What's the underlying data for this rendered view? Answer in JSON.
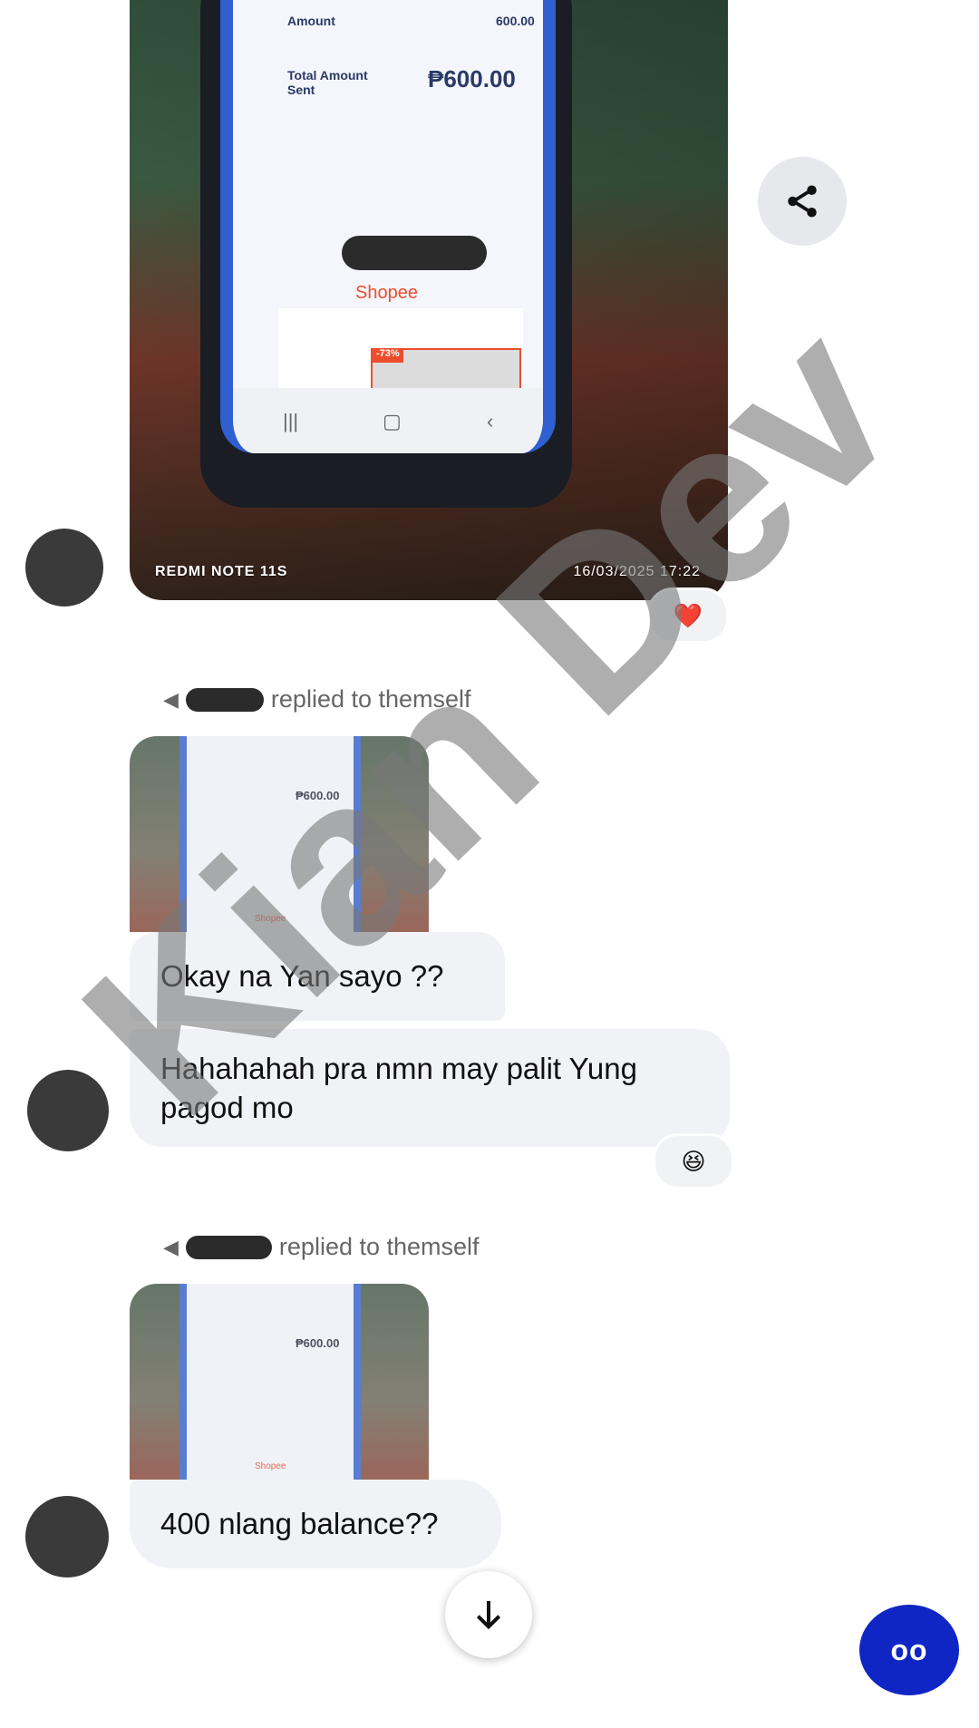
{
  "photo": {
    "screen_amount_label": "Amount",
    "screen_amount_value": "600.00",
    "screen_total_label": "Total Amount Sent",
    "screen_total_value": "₱600.00",
    "screen_shopee": "Shopee",
    "screen_promo": "-73%",
    "caption_device": "REDMI NOTE 11S",
    "caption_timestamp": "16/03/2025  17:22",
    "icon": "image"
  },
  "reactions": {
    "first": "❤️",
    "second": "😆"
  },
  "replies": [
    {
      "label": "replied to themself"
    },
    {
      "label": "replied to themself"
    }
  ],
  "thumbs": [
    {
      "amount": "₱600.00",
      "shopee": "Shopee"
    },
    {
      "amount": "₱600.00",
      "shopee": "Shopee"
    }
  ],
  "messages": [
    {
      "text": "Okay na Yan sayo ??"
    },
    {
      "text": "Hahahahah pra nmn may palit Yung pagod mo"
    },
    {
      "text": "400 nlang balance??"
    }
  ],
  "buttons": {
    "share_icon": "share-icon",
    "scroll_icon": "arrow-down-icon",
    "fab_label": "oo"
  },
  "watermark": "Kian Dev",
  "colors": {
    "bubble": "#f1f2f6",
    "fab": "#1026c4"
  }
}
